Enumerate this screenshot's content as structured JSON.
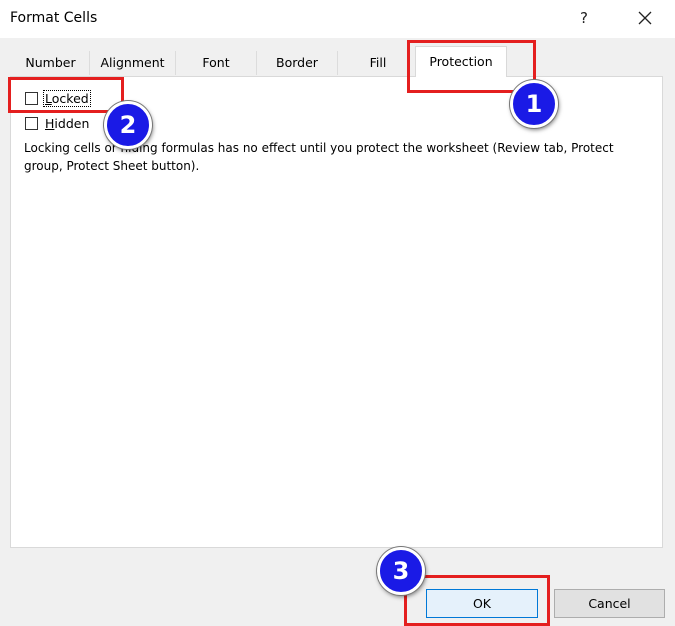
{
  "dialog": {
    "title": "Format Cells",
    "help_label": "?"
  },
  "tabs": [
    {
      "label": "Number"
    },
    {
      "label": "Alignment"
    },
    {
      "label": "Font"
    },
    {
      "label": "Border"
    },
    {
      "label": "Fill"
    },
    {
      "label": "Protection",
      "active": true
    }
  ],
  "protection": {
    "locked_label": "Locked",
    "locked_checked": false,
    "hidden_label": "Hidden",
    "hidden_checked": false,
    "info_text": "Locking cells or hiding formulas has no effect until you protect the worksheet (Review tab, Protect group, Protect Sheet button)."
  },
  "buttons": {
    "ok_label": "OK",
    "cancel_label": "Cancel"
  },
  "annotations": {
    "badge_1": "1",
    "badge_2": "2",
    "badge_3": "3",
    "highlight_color": "#e41f1f",
    "badge_color": "#1a1ae6"
  }
}
